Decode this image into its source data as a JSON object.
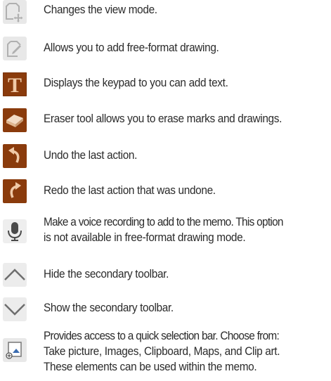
{
  "items": [
    {
      "icon": "view-mode-icon",
      "lines": [
        "Changes the view mode."
      ]
    },
    {
      "icon": "pen-icon",
      "lines": [
        "Allows you to add free-format drawing."
      ]
    },
    {
      "icon": "text-icon",
      "glyph": "T",
      "lines": [
        "Displays the keypad to you can add text."
      ]
    },
    {
      "icon": "eraser-icon",
      "lines": [
        "Eraser tool allows you to erase marks and drawings."
      ]
    },
    {
      "icon": "undo-icon",
      "lines": [
        "Undo the last action."
      ]
    },
    {
      "icon": "redo-icon",
      "lines": [
        "Redo the last action that was undone."
      ]
    },
    {
      "icon": "microphone-icon",
      "lines": [
        "Make a voice recording to add to the memo. This option",
        "is not available in free-format drawing mode."
      ]
    },
    {
      "icon": "chevron-up-icon",
      "lines": [
        "Hide the secondary toolbar."
      ]
    },
    {
      "icon": "chevron-down-icon",
      "lines": [
        "Show the secondary toolbar."
      ]
    },
    {
      "icon": "insert-icon",
      "lines": [
        "Provides access to a quick selection bar. Choose from:",
        "Take picture, Images, Clipboard, Maps, and Clip art.",
        "These elements can be used within the memo."
      ]
    }
  ],
  "colors": {
    "icon_brown": "#8a3b0c",
    "icon_brown_dark": "#6b2b08",
    "icon_gray": "#bdbdbd",
    "icon_bg": "#e6e6e6",
    "text": "#2b2b2b"
  }
}
